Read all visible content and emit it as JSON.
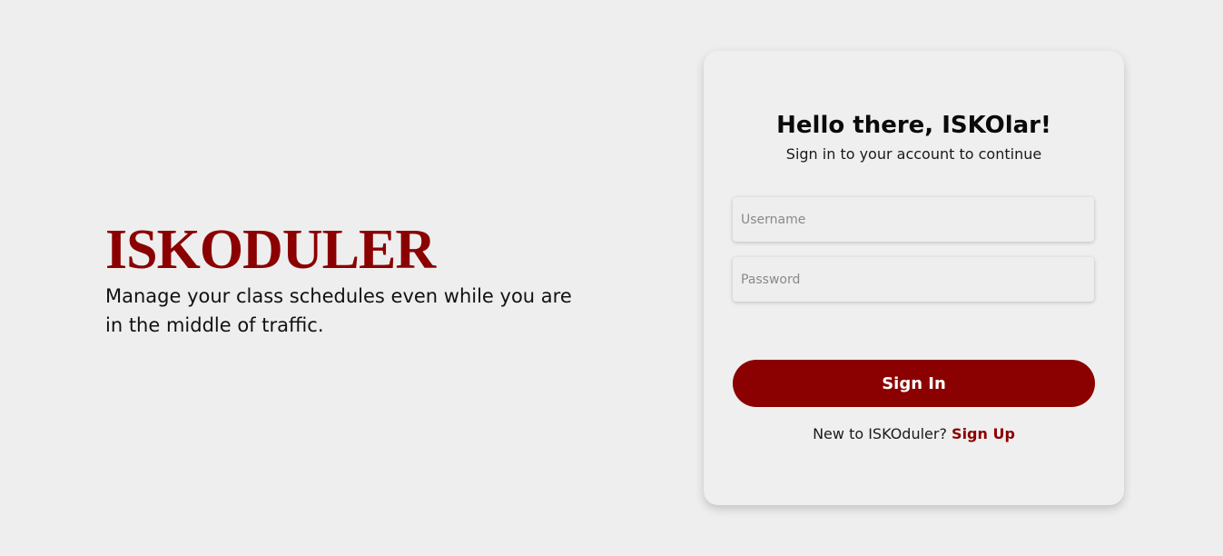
{
  "hero": {
    "brand": "ISKODULER",
    "tagline": "Manage your class schedules even while you are in the middle of traffic."
  },
  "login": {
    "title": "Hello there, ISKOlar!",
    "subtitle": "Sign in to your account to continue",
    "username_placeholder": "Username",
    "username_value": "",
    "password_placeholder": "Password",
    "password_value": "",
    "signin_label": "Sign In",
    "signup_prompt": "New to ISKOduler?",
    "signup_link": "Sign Up"
  },
  "colors": {
    "background": "#eeeeee",
    "brand": "#8b0000",
    "card": "#efefef",
    "text": "#111111"
  }
}
